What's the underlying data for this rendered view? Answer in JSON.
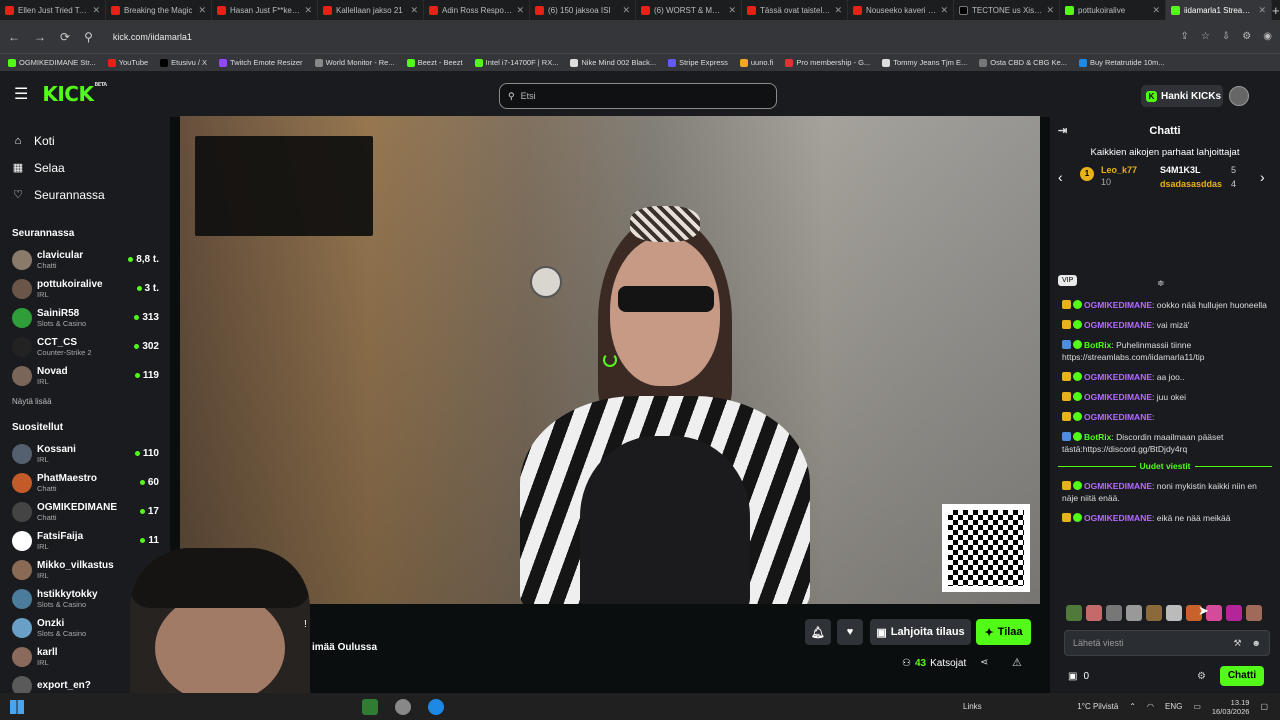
{
  "browser": {
    "tabs": [
      {
        "label": "Ellen Just Tried To C",
        "favicon": "yt"
      },
      {
        "label": "Breaking the Magic",
        "favicon": "yt"
      },
      {
        "label": "Hasan Just F**ked U",
        "favicon": "yt"
      },
      {
        "label": "Kallellaan jakso 21",
        "favicon": "yt"
      },
      {
        "label": "Adin Ross Respond",
        "favicon": "yt"
      },
      {
        "label": "(6) 150 jaksoa ISI",
        "favicon": "yt"
      },
      {
        "label": "(6) WORST & MOST",
        "favicon": "yt"
      },
      {
        "label": "Tässä ovat taistelua",
        "favicon": "yt"
      },
      {
        "label": "Nouseeko kaveri ilm",
        "favicon": "yt"
      },
      {
        "label": "TECTONE us Xissa",
        "favicon": "x"
      },
      {
        "label": "pottukoiralive",
        "favicon": "kick"
      },
      {
        "label": "iidamarla1 Stream - Watc",
        "favicon": "kick",
        "active": true
      }
    ],
    "url": "kick.com/iidamarla1",
    "bookmarks": [
      {
        "label": "OGMIKEDIMANE Str...",
        "color": "#53fc18"
      },
      {
        "label": "YouTube",
        "color": "#e62117"
      },
      {
        "label": "Etusivu / X",
        "color": "#000000"
      },
      {
        "label": "Twitch Emote Resizer",
        "color": "#9146ff"
      },
      {
        "label": "World Monitor - Re...",
        "color": "#888888"
      },
      {
        "label": "Beezt - Beezt",
        "color": "#53fc18"
      },
      {
        "label": "Intel i7-14700F | RX...",
        "color": "#53fc18"
      },
      {
        "label": "Nike Mind 002 Black...",
        "color": "#dddddd"
      },
      {
        "label": "Stripe Express",
        "color": "#635bff"
      },
      {
        "label": "uuno.fi",
        "color": "#f5a623"
      },
      {
        "label": "Pro membership - G...",
        "color": "#d33"
      },
      {
        "label": "Tommy Jeans Tjm E...",
        "color": "#dddddd"
      },
      {
        "label": "Osta CBD & CBG Ke...",
        "color": "#777777"
      },
      {
        "label": "Buy Retatrutide 10m...",
        "color": "#1e88e5"
      }
    ]
  },
  "header": {
    "logo": "KICK",
    "logo_badge": "BETA",
    "search_placeholder": "Etsi",
    "get_kicks_label": "Hanki KICKs"
  },
  "sidebar": {
    "nav": [
      {
        "label": "Koti",
        "icon": "home-icon",
        "glyph": "⌂"
      },
      {
        "label": "Selaa",
        "icon": "browse-icon",
        "glyph": "▦"
      },
      {
        "label": "Seurannassa",
        "icon": "heart-icon",
        "glyph": "♡"
      }
    ],
    "following_title": "Seurannassa",
    "following": [
      {
        "name": "clavicular",
        "category": "Chatti",
        "viewers": "8,8 t.",
        "color": "#8a7a6a"
      },
      {
        "name": "pottukoiralive",
        "category": "IRL",
        "viewers": "3 t.",
        "color": "#6b5548"
      },
      {
        "name": "SainiR58",
        "category": "Slots & Casino",
        "viewers": "313",
        "color": "#2e9d3a"
      },
      {
        "name": "CCT_CS",
        "category": "Counter-Strike 2",
        "viewers": "302",
        "color": "#222222"
      },
      {
        "name": "Novad",
        "category": "IRL",
        "viewers": "119",
        "color": "#7a6658"
      }
    ],
    "show_more_label": "Näytä lisää",
    "recommended_title": "Suositellut",
    "recommended": [
      {
        "name": "Kossani",
        "category": "IRL",
        "viewers": "110",
        "color": "#55606e"
      },
      {
        "name": "PhatMaestro",
        "category": "Chatti",
        "viewers": "60",
        "color": "#c25a2a"
      },
      {
        "name": "OGMIKEDIMANE",
        "category": "Chatti",
        "viewers": "17",
        "color": "#444444"
      },
      {
        "name": "FatsiFaija",
        "category": "IRL",
        "viewers": "11",
        "color": "#ffffff"
      },
      {
        "name": "Mikko_vilkastus",
        "category": "IRL",
        "viewers": "",
        "color": "#8b6a55"
      },
      {
        "name": "hstikkytokky",
        "category": "Slots & Casino",
        "viewers": "",
        "color": "#4c7c9c"
      },
      {
        "name": "Onzki",
        "category": "Slots & Casino",
        "viewers": "",
        "color": "#6aa0c8"
      },
      {
        "name": "karll",
        "category": "IRL",
        "viewers": "",
        "color": "#8a6a5a"
      },
      {
        "name": "export_en?",
        "category": "",
        "viewers": "",
        "color": "#5a5a5a"
      }
    ]
  },
  "stream": {
    "title_fragment": "imää Oulussa",
    "title_mark": "!",
    "gift_sub_label": "Lahjoita tilaus",
    "subscribe_label": "Tilaa",
    "viewers_count": "43",
    "viewers_label": "Katsojat"
  },
  "chat": {
    "title": "Chatti",
    "top_gifters_title": "Kaikkien aikojen parhaat lahjoittajat",
    "gifters": [
      {
        "name": "Leo_k77",
        "count": "10",
        "color": "#e8b21a"
      },
      {
        "name": "S4M1K3L",
        "count": "5",
        "color": "#ffffff"
      },
      {
        "name": "dsadasasddas",
        "count": "4",
        "color": "#e8b21a"
      }
    ],
    "vip_label": "VIP",
    "messages": [
      {
        "user": "OGMIKEDIMANE",
        "text": "ookko nää hullujen huoneella",
        "bot": false
      },
      {
        "user": "OGMIKEDIMANE",
        "text": "vai mizä'",
        "bot": false
      },
      {
        "user": "BotRix",
        "text": "Puhelinmassii tiinne https://streamlabs.com/iidamarla11/tip",
        "bot": true
      },
      {
        "user": "OGMIKEDIMANE",
        "text": "aa joo..",
        "bot": false
      },
      {
        "user": "OGMIKEDIMANE",
        "text": "juu okei",
        "bot": false
      },
      {
        "user": "OGMIKEDIMANE",
        "text": "",
        "bot": false
      },
      {
        "user": "BotRix",
        "text": "Discordin maailmaan pääset tästä:https://discord.gg/BtDjdy4rq",
        "bot": true
      }
    ],
    "new_messages_label": "Uudet viestit",
    "new_messages": [
      {
        "user": "OGMIKEDIMANE",
        "text": "noni mykistin kaikki niin en näje niitä enää.",
        "bot": false
      },
      {
        "user": "OGMIKEDIMANE",
        "text": "eikä ne nää meikää",
        "bot": false
      }
    ],
    "input_placeholder": "Lähetä viesti",
    "points": "0",
    "send_label": "Chatti"
  },
  "taskbar": {
    "links_label": "Links",
    "weather": "1°C  Pilvistä",
    "lang": "ENG",
    "time": "13.19",
    "date": "16/03/2026"
  }
}
